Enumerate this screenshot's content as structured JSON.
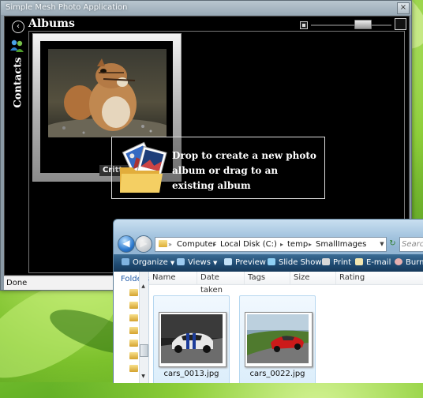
{
  "app": {
    "title": "Simple Mesh Photo Application",
    "close_glyph": "×",
    "status": "Done",
    "header": {
      "back_glyph": "‹",
      "title": "Albums"
    },
    "contacts_tab": {
      "label": "Contacts",
      "icon": "people-icon"
    },
    "zoom_slider": {
      "level": 0.6
    },
    "album": {
      "label": "Critter"
    },
    "drop_tooltip": {
      "text": "Drop to create a new photo album or drag to an existing album",
      "icon": "folder-with-photos-icon"
    }
  },
  "explorer": {
    "address": {
      "parts": [
        "Computer",
        "Local Disk (C:)",
        "temp",
        "SmallImages"
      ],
      "separator": "▸",
      "lead_separator": "»"
    },
    "search_placeholder": "Search",
    "toolbar": {
      "items": [
        {
          "label": "Organize",
          "icon": "organize-icon",
          "dropdown": true
        },
        {
          "label": "Views",
          "icon": "views-icon",
          "dropdown": true
        },
        {
          "label": "Preview",
          "icon": "preview-icon",
          "dropdown": false
        },
        {
          "label": "Slide Show",
          "icon": "slideshow-icon",
          "dropdown": false
        },
        {
          "label": "Print",
          "icon": "print-icon",
          "dropdown": false
        },
        {
          "label": "E-mail",
          "icon": "email-icon",
          "dropdown": false
        },
        {
          "label": "Burn",
          "icon": "burn-icon",
          "dropdown": false
        }
      ]
    },
    "folders_label": "Folders",
    "columns": [
      "Name",
      "Date taken",
      "Tags",
      "Size",
      "Rating"
    ],
    "files": [
      {
        "name": "cars_0013.jpg"
      },
      {
        "name": "cars_0022.jpg"
      }
    ],
    "colors": {
      "toolbar": "#1e4970",
      "selection": "#dceefb",
      "folder": "#f0c94e"
    }
  }
}
